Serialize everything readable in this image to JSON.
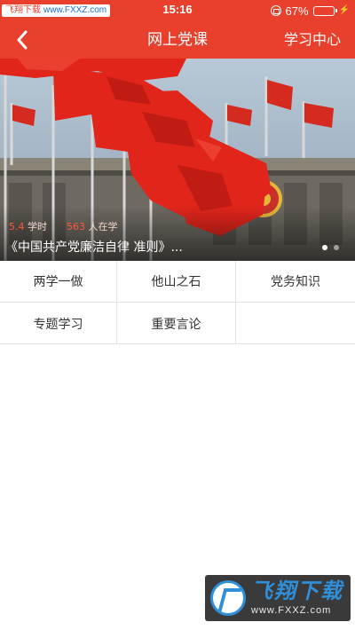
{
  "status_bar": {
    "watermark_label": "飞翔下载",
    "watermark_url": "www.FXXZ.com",
    "time": "15:16",
    "battery_percent": "67%",
    "battery_level": 0.67
  },
  "nav": {
    "title": "网上党课",
    "right_link": "学习中心",
    "back_icon": "chevron-left-icon"
  },
  "banner": {
    "hours_value": "5.4",
    "hours_unit": "学时",
    "learners_value": "563",
    "learners_unit": "人在学",
    "title": "《中国共产党廉洁自律 准则》...",
    "page_count": 2,
    "active_page": 1
  },
  "categories": [
    {
      "label": "两学一做"
    },
    {
      "label": "他山之石"
    },
    {
      "label": "党务知识"
    },
    {
      "label": "专题学习"
    },
    {
      "label": "重要言论"
    },
    {
      "label": ""
    }
  ],
  "watermark_br": {
    "brand": "飞翔下载",
    "site": "www.FXXZ.com"
  },
  "colors": {
    "brand_red": "#e8402c",
    "watermark_blue": "#2f8fd8"
  }
}
